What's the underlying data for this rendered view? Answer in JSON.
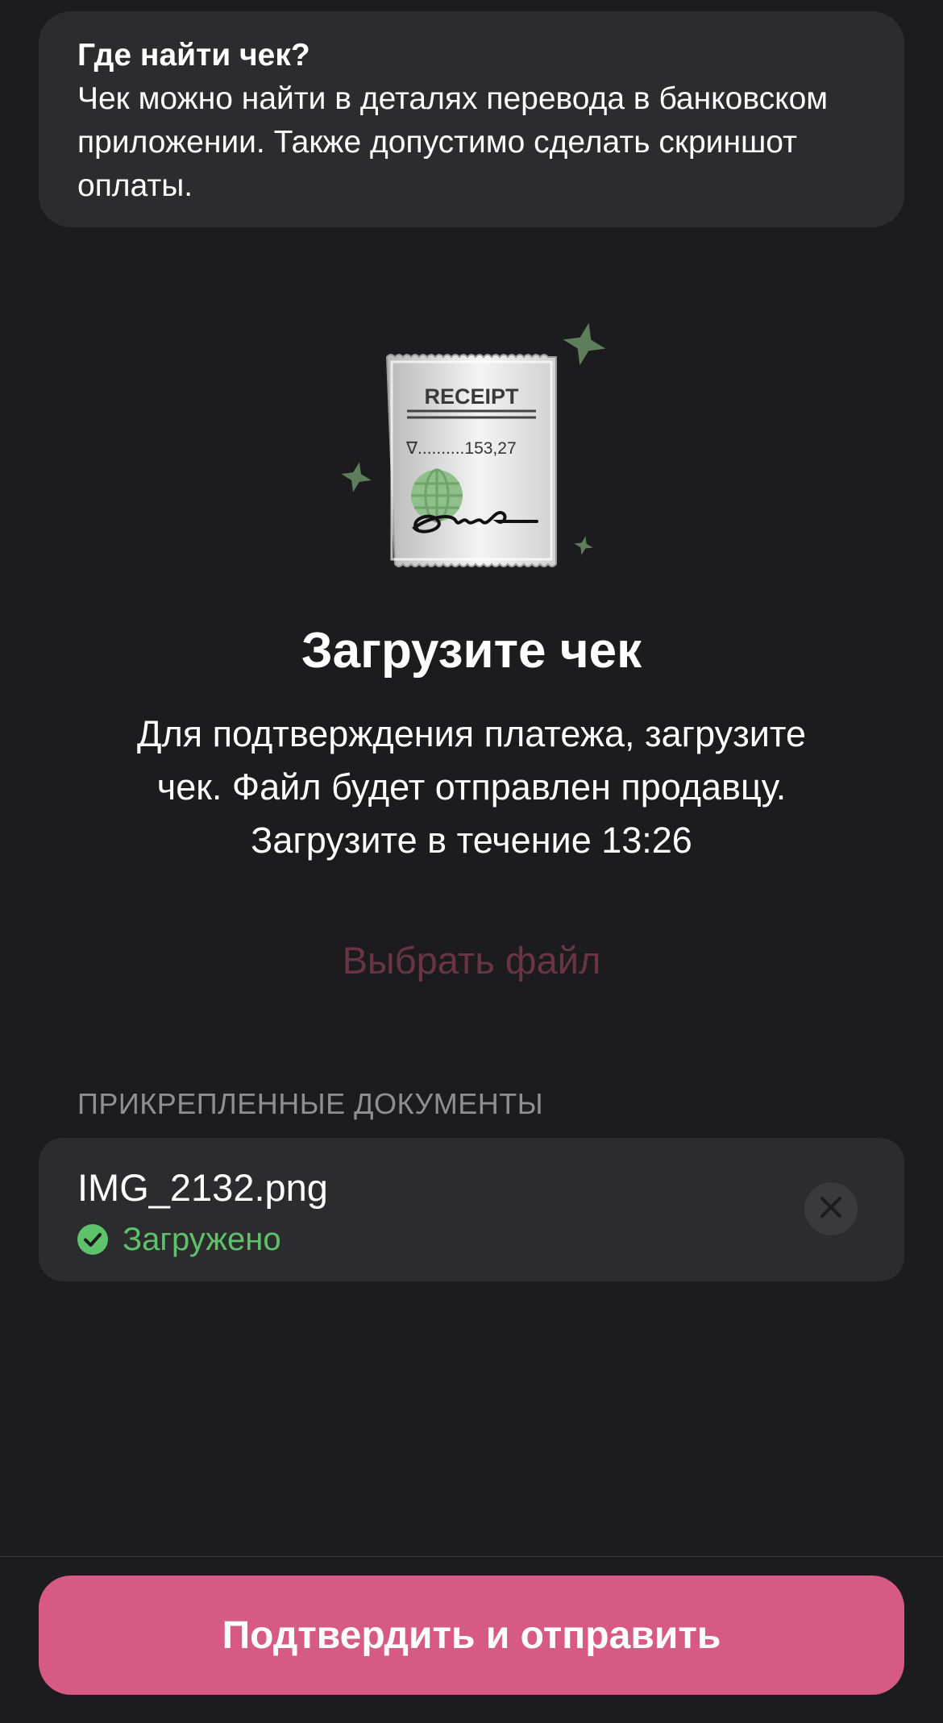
{
  "info": {
    "title": "Где найти чек?",
    "body": "Чек можно найти в деталях перевода в банковском приложении. Также допустимо сделать скриншот оплаты."
  },
  "illustration": {
    "receipt_title": "RECEIPT",
    "receipt_amount": "∇..........153,27"
  },
  "upload": {
    "title": "Загрузите чек",
    "description_line1": "Для подтверждения платежа, загрузите",
    "description_line2": "чек. Файл будет отправлен продавцу.",
    "description_line3": "Загрузите в течение 13:26",
    "choose_file_label": "Выбрать файл"
  },
  "attachments": {
    "header": "ПРИКРЕПЛЕННЫЕ ДОКУМЕНТЫ",
    "items": [
      {
        "name": "IMG_2132.png",
        "status": "Загружено",
        "status_icon": "check-circle-icon",
        "remove_icon": "close-icon"
      }
    ]
  },
  "footer": {
    "confirm_label": "Подтвердить и отправить"
  },
  "colors": {
    "background": "#1c1c1e",
    "card": "#2c2c2e",
    "accent": "#d65a83",
    "choose_file_text": "#6a3444",
    "success": "#5ec26a",
    "secondary_text": "#8e8e93",
    "sparkle": "#5e7d5a"
  }
}
